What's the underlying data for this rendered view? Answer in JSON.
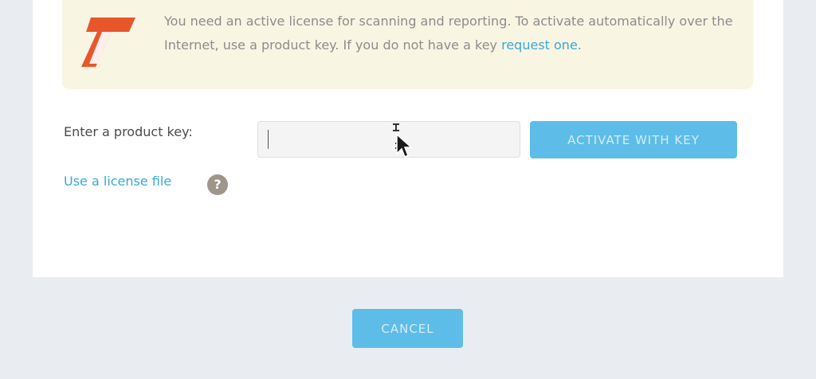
{
  "notice": {
    "text": "You need an active license for scanning and reporting. To activate automatically over the Internet, use a product key. If you do not have a key",
    "link_label": "request one",
    "suffix": "."
  },
  "product_key": {
    "label": "Enter a product key:",
    "value": "",
    "placeholder": ""
  },
  "buttons": {
    "activate_label": "ACTIVATE WITH KEY",
    "cancel_label": "CANCEL"
  },
  "license_file": {
    "link_label": "Use a license file",
    "help_glyph": "?"
  },
  "colors": {
    "accent": "#5dbde8",
    "link": "#3aa8d8",
    "logo_orange": "#e8572c",
    "notice_bg": "#f9f5e3",
    "page_bg": "#e9edf2"
  },
  "icons": {
    "logo": "brand-logo-icon",
    "help": "question-help-icon",
    "cursor": "mouse-pointer-icon"
  }
}
